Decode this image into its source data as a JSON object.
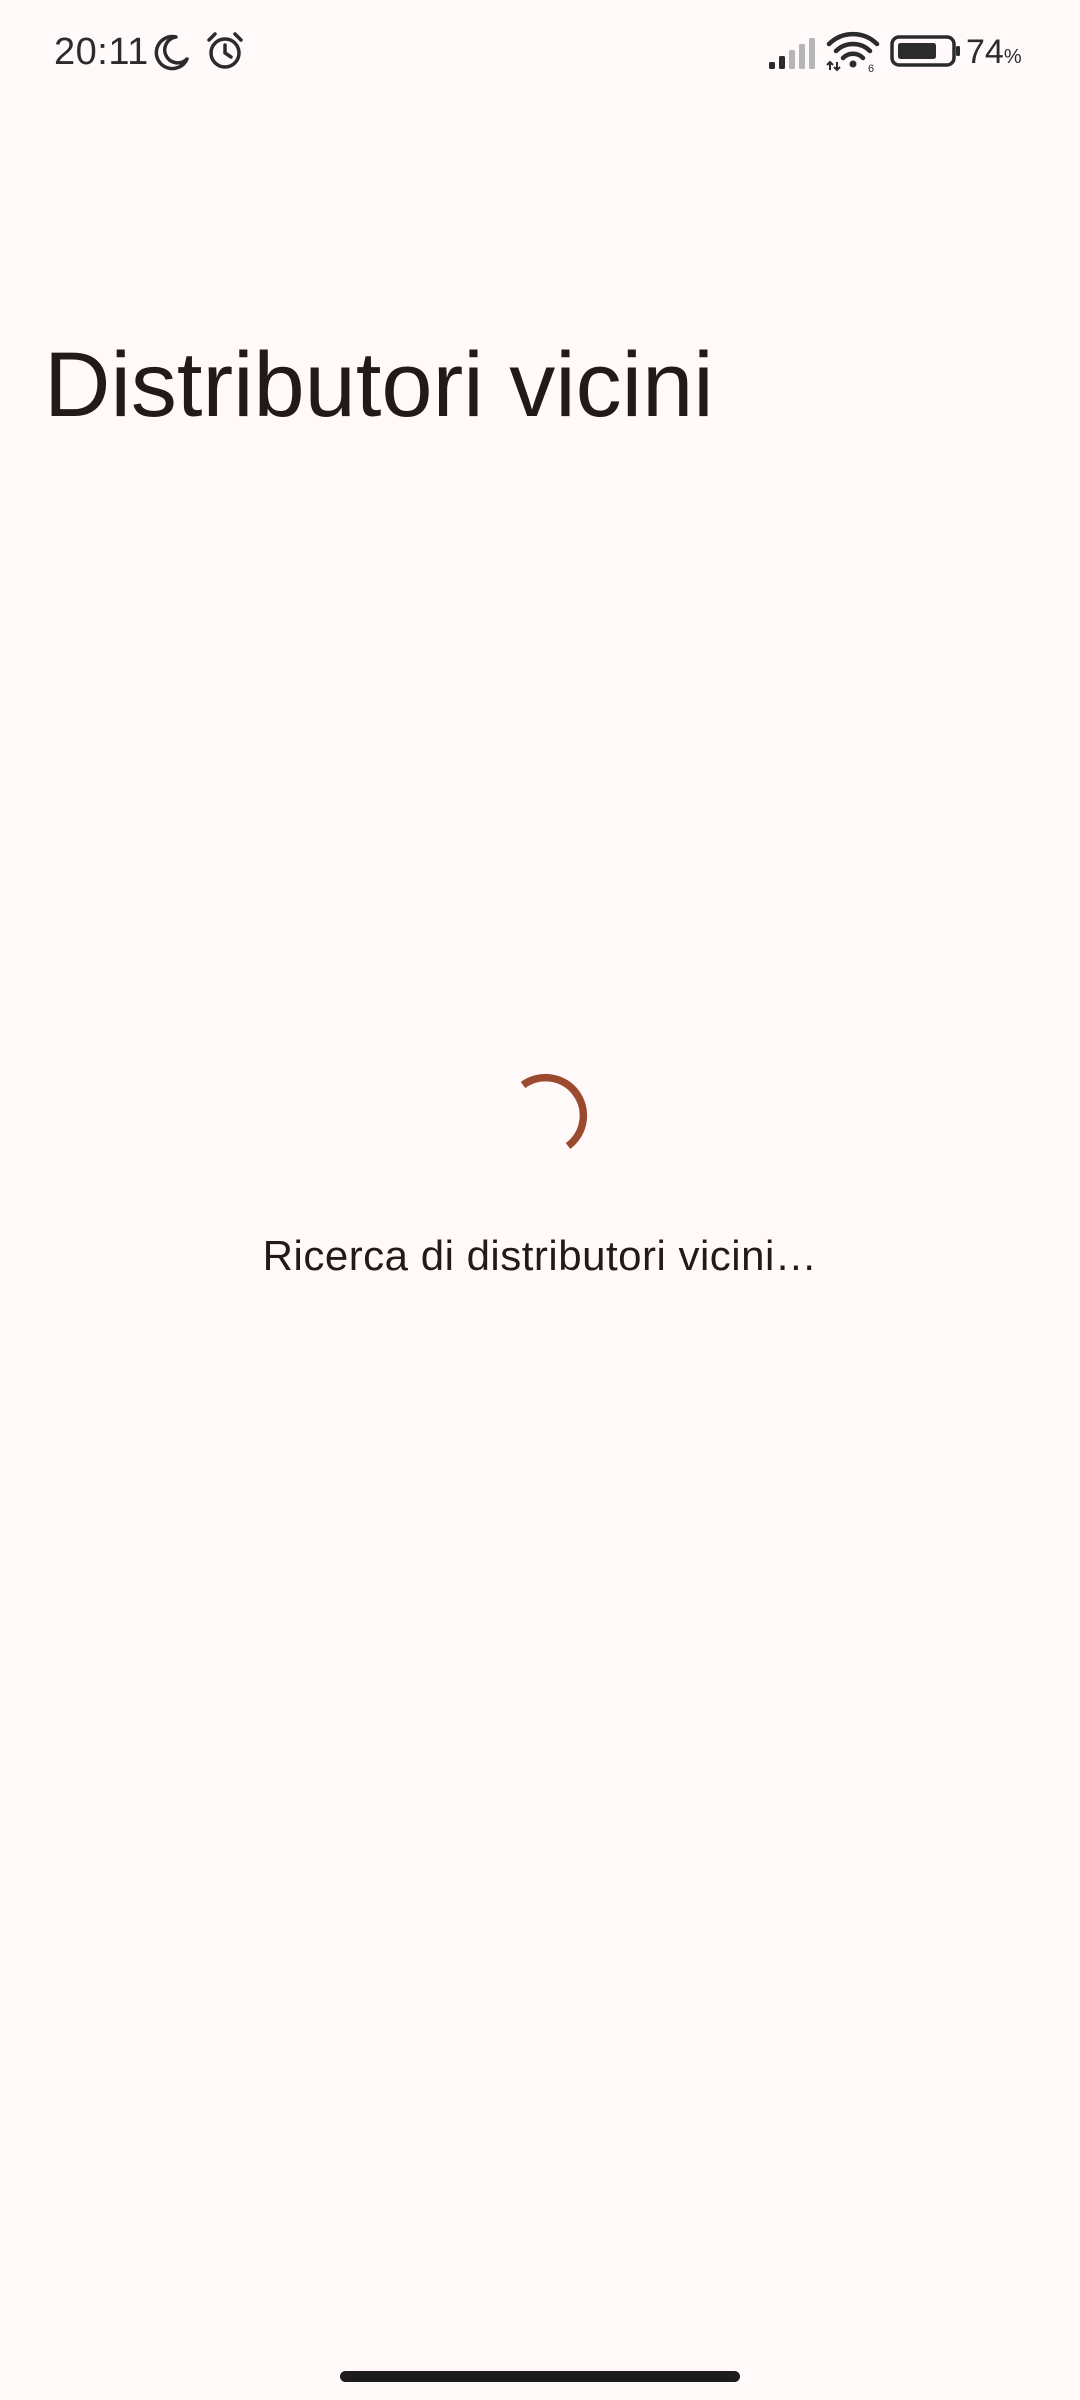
{
  "status_bar": {
    "time": "20:11",
    "battery_level": "74",
    "battery_unit": "%",
    "wifi_label": "6",
    "icons": [
      "moon-icon",
      "alarm-icon",
      "signal-icon",
      "wifi-icon",
      "battery-icon"
    ]
  },
  "header": {
    "title": "Distributori vicini"
  },
  "main": {
    "loading_text": "Ricerca di distributori vicini…"
  },
  "colors": {
    "background": "#fffaf9",
    "text": "#221a19",
    "accent": "#9c4a2f"
  }
}
